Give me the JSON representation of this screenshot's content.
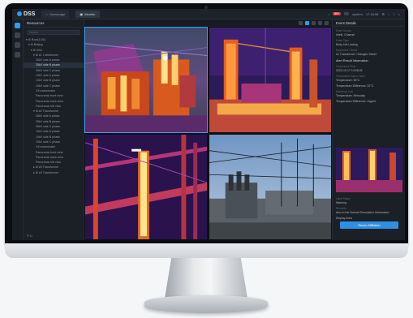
{
  "app": {
    "logo_text": "DSS",
    "tabs": [
      {
        "label": "Homepage"
      },
      {
        "label": "Monitor"
      }
    ],
    "alarm_badge": "99+",
    "user_label": "system",
    "time_label": "17:18:08"
  },
  "resources": {
    "title": "Resources",
    "search_placeholder": "Search",
    "items": [
      {
        "label": "▾ ⊞ Root(1/26)",
        "indent": 0
      },
      {
        "label": "▾ ⊞ Beijing",
        "indent": 1
      },
      {
        "label": "▾ ⊞ Xihe",
        "indent": 2
      },
      {
        "label": "▾ ⊞ #1 Transformer",
        "indent": 3
      },
      {
        "label": "35kV side A phase",
        "indent": 4
      },
      {
        "label": "35kV side B phase",
        "indent": 4,
        "selected": true
      },
      {
        "label": "35kV side C phase",
        "indent": 4
      },
      {
        "label": "10kV side A phase",
        "indent": 4
      },
      {
        "label": "10kV side B phase",
        "indent": 4
      },
      {
        "label": "10kV side C phase",
        "indent": 4
      },
      {
        "label": "Oil conservator",
        "indent": 4
      },
      {
        "label": "Panoramic front view",
        "indent": 4
      },
      {
        "label": "Panoramic back view",
        "indent": 4
      },
      {
        "label": "Panoramic left view",
        "indent": 4
      },
      {
        "label": "▾ ⊞ #2 Transformer",
        "indent": 3
      },
      {
        "label": "35kV side A phase",
        "indent": 4
      },
      {
        "label": "35kV side B phase",
        "indent": 4
      },
      {
        "label": "35kV side C phase",
        "indent": 4
      },
      {
        "label": "10kV side A phase",
        "indent": 4
      },
      {
        "label": "10kV side B phase",
        "indent": 4
      },
      {
        "label": "10kV side C phase",
        "indent": 4
      },
      {
        "label": "Oil conservator",
        "indent": 4
      },
      {
        "label": "Panoramic front view",
        "indent": 4
      },
      {
        "label": "Panoramic back view",
        "indent": 4
      },
      {
        "label": "Panoramic left view",
        "indent": 4
      },
      {
        "label": "▸ ⊞ #3 Transformer",
        "indent": 3
      },
      {
        "label": "▸ ⊞ #4 Transformer",
        "indent": 3
      }
    ],
    "footer": "IP12"
  },
  "panel": {
    "title": "Event Details",
    "fields": [
      {
        "label": "Event Source",
        "value": "Intelli. Channel"
      },
      {
        "label": "Event Type",
        "value": "Body Hot Lasting"
      },
      {
        "label": "Equipment / Name",
        "value": "#1 Transformer / Daxigbo Street"
      }
    ],
    "section_title": "Alert Result Information",
    "fields2": [
      {
        "label": "Occurrence Time",
        "value": "2023-10-17 14:08:28"
      },
      {
        "label": "Temperature Alarm Value",
        "value": "Temperature: 83°C"
      },
      {
        "label": "",
        "value": "Temperature Difference: 22°C"
      },
      {
        "label": "Alarming Level",
        "value": "Temperature: Seriously"
      },
      {
        "label": "",
        "value": "Temperature Difference: Urgent"
      }
    ],
    "fields3": [
      {
        "label": "Label Status",
        "value": "Warning"
      },
      {
        "label": "Remarks",
        "value": "Also in the Normal Description Information"
      },
      {
        "label": "",
        "value": "Display Area"
      }
    ],
    "button_label": "Recon Affiliation"
  },
  "colors": {
    "accent": "#2f9cf0",
    "screen_bg": "#15191f"
  }
}
